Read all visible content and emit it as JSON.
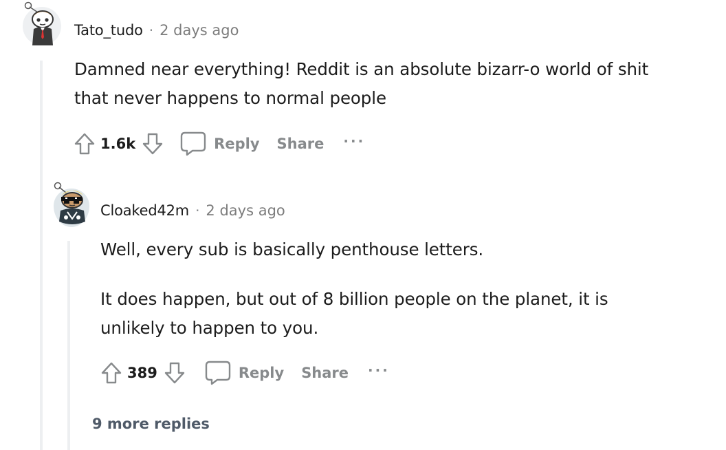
{
  "comments": [
    {
      "author": "Tato_tudo",
      "separator": "·",
      "time": "2 days ago",
      "body": [
        "Damned near everything! Reddit is an absolute bizarr-o world of shit that never happens to normal people"
      ],
      "score": "1.6k",
      "reply_label": "Reply",
      "share_label": "Share",
      "more_label": "···"
    },
    {
      "author": "Cloaked42m",
      "separator": "·",
      "time": "2 days ago",
      "body": [
        "Well, every sub is basically penthouse letters.",
        "It does happen, but out of 8 billion people on the planet, it is unlikely to happen to you."
      ],
      "score": "389",
      "reply_label": "Reply",
      "share_label": "Share",
      "more_label": "···"
    }
  ],
  "more_replies_label": "9 more replies",
  "colors": {
    "thread_line": "#edeff1",
    "muted": "#878a8c",
    "text": "#1c1c1c"
  }
}
